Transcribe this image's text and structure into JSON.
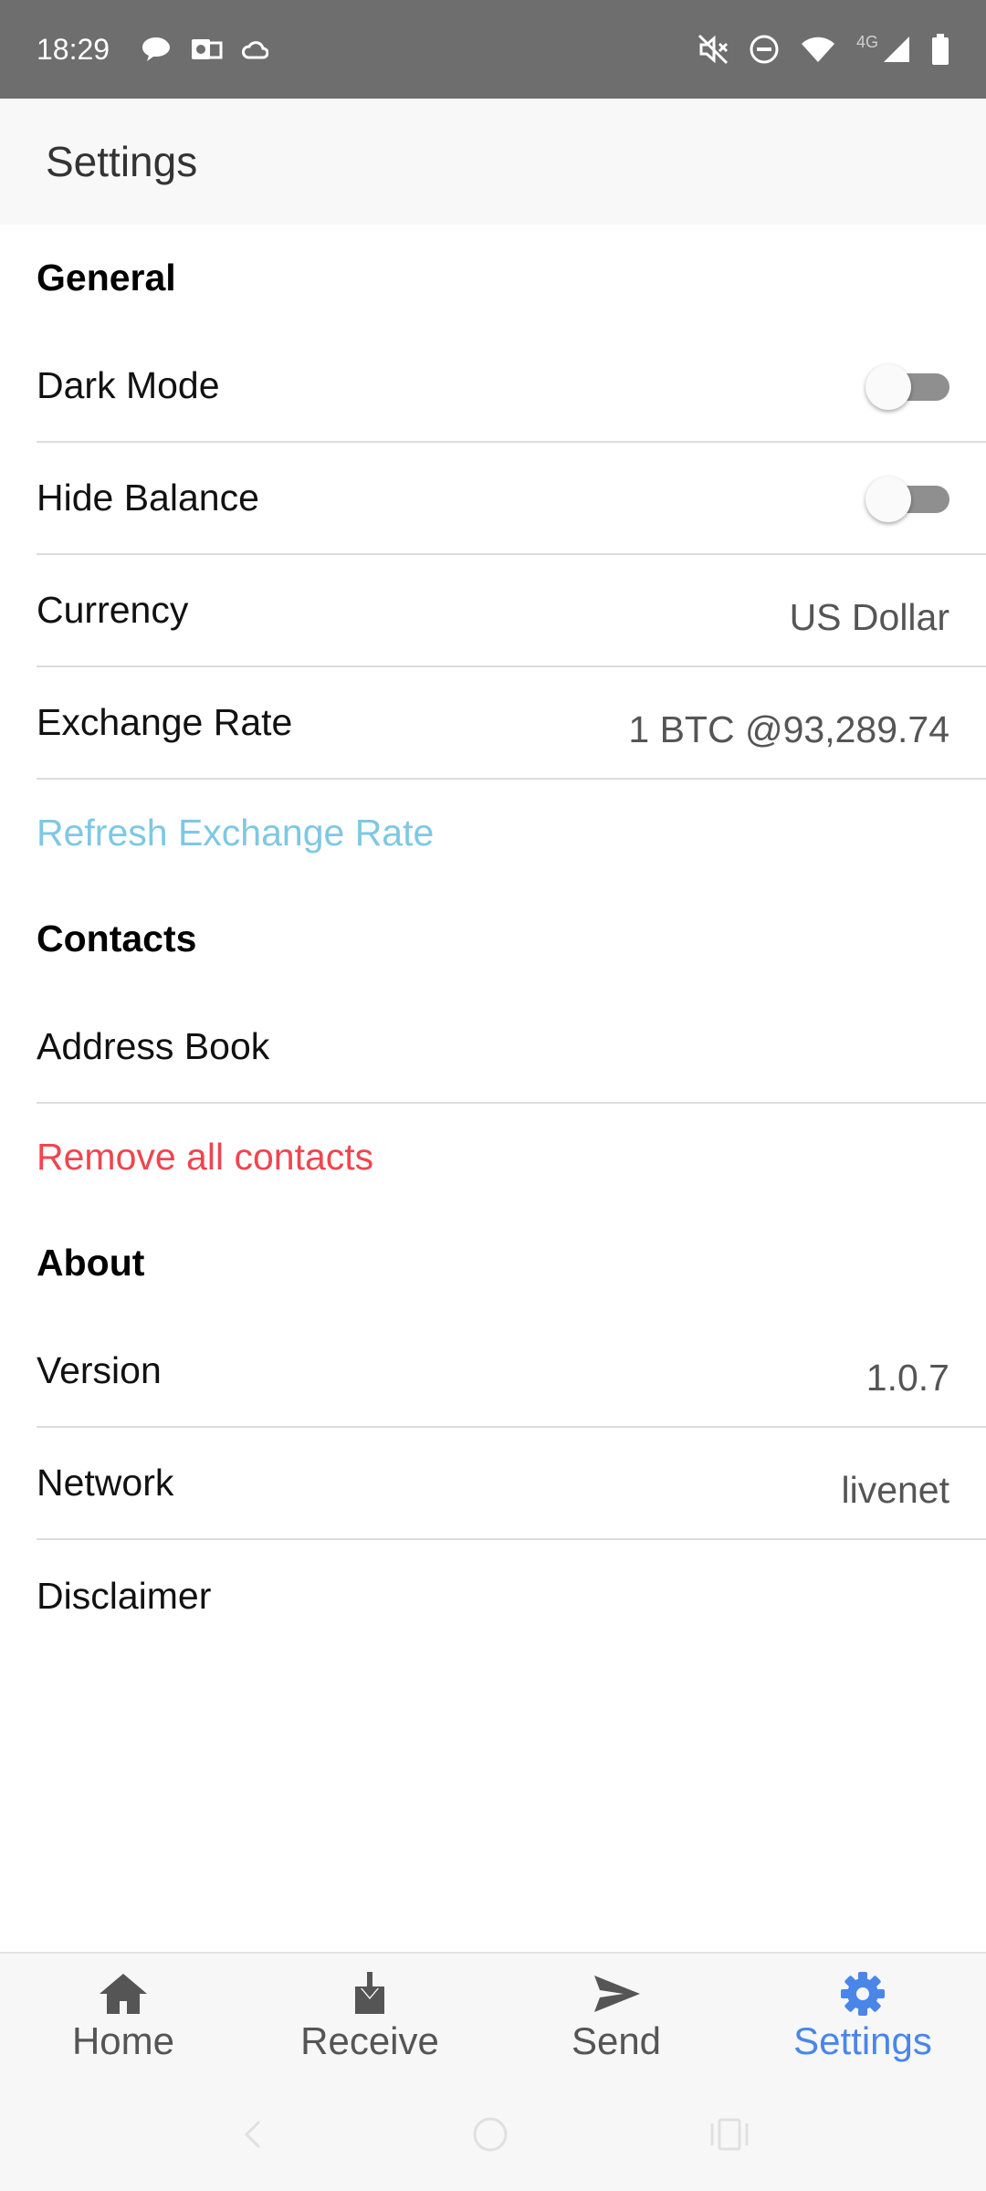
{
  "status_bar": {
    "time": "18:29",
    "network_label": "4G",
    "left_icons": [
      "chat-icon",
      "outlook-icon",
      "cloud-icon"
    ],
    "right_icons": [
      "mute-icon",
      "dnd-icon",
      "wifi-icon",
      "signal-icon",
      "battery-icon"
    ]
  },
  "header": {
    "title": "Settings"
  },
  "general": {
    "title": "General",
    "dark_mode": {
      "label": "Dark Mode",
      "enabled": false
    },
    "hide_balance": {
      "label": "Hide Balance",
      "enabled": false
    },
    "currency": {
      "label": "Currency",
      "value": "US Dollar"
    },
    "exchange_rate": {
      "label": "Exchange Rate",
      "value": "1 BTC @93,289.74"
    },
    "refresh_label": "Refresh Exchange Rate"
  },
  "contacts": {
    "title": "Contacts",
    "address_book_label": "Address Book",
    "remove_all_label": "Remove all contacts"
  },
  "about": {
    "title": "About",
    "version": {
      "label": "Version",
      "value": "1.0.7"
    },
    "network": {
      "label": "Network",
      "value": "livenet"
    },
    "disclaimer_label": "Disclaimer"
  },
  "tabs": [
    {
      "label": "Home",
      "icon": "home-icon",
      "active": false
    },
    {
      "label": "Receive",
      "icon": "receive-icon",
      "active": false
    },
    {
      "label": "Send",
      "icon": "send-icon",
      "active": false
    },
    {
      "label": "Settings",
      "icon": "gear-icon",
      "active": true
    }
  ],
  "colors": {
    "accent": "#4a86e8",
    "link_blue": "#7ec8e3",
    "danger_red": "#f0454f",
    "status_bar": "#6e6e6e"
  }
}
